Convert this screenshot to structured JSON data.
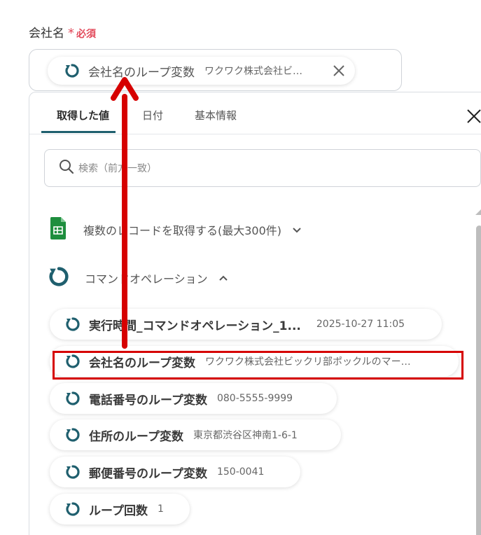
{
  "field": {
    "label": "会社名",
    "required_mark": "*",
    "required_text": "必須"
  },
  "selected_value": {
    "name": "会社名のループ変数",
    "value": "ワクワク株式会社ビ…"
  },
  "tabs": [
    {
      "label": "取得した値"
    },
    {
      "label": "日付"
    },
    {
      "label": "基本情報"
    }
  ],
  "search": {
    "placeholder": "検索（前方一致）"
  },
  "sections": [
    {
      "title": "複数のレコードを取得する(最大300件)",
      "icon": "google-sheets-icon",
      "expanded": false
    },
    {
      "title": "コマンドオペレーション",
      "icon": "loop-icon",
      "expanded": true
    }
  ],
  "items": [
    {
      "name": "実行時間_コマンドオペレーション_1...",
      "value": "2025-10-27 11:05"
    },
    {
      "name": "会社名のループ変数",
      "value": "ワクワク株式会社ビックリ部ポックルのマー…"
    },
    {
      "name": "電話番号のループ変数",
      "value": "080-5555-9999"
    },
    {
      "name": "住所のループ変数",
      "value": "東京都渋谷区神南1-6-1"
    },
    {
      "name": "郵便番号のループ変数",
      "value": "150-0041"
    },
    {
      "name": "ループ回数",
      "value": "1"
    }
  ],
  "colors": {
    "accent": "#1f5f6e",
    "required": "#e2495a",
    "annotation": "#d60000",
    "sheets_green": "#1e8e3e"
  }
}
